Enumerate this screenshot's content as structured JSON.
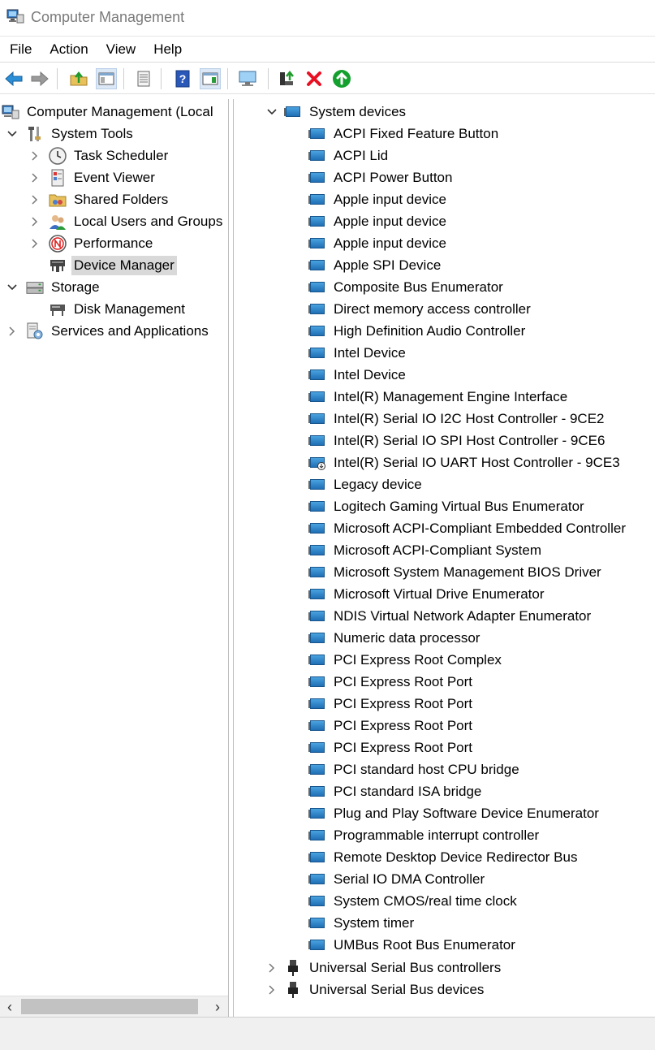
{
  "window": {
    "title": "Computer Management"
  },
  "menu": [
    "File",
    "Action",
    "View",
    "Help"
  ],
  "toolbar": {
    "buttons": [
      "back-icon",
      "forward-icon",
      "up-folder-icon",
      "show-hide-tree-icon",
      "properties-icon",
      "help-icon",
      "show-hide-action-pane-icon",
      "monitor-icon",
      "update-driver-icon",
      "uninstall-icon",
      "enable-device-icon"
    ]
  },
  "left_tree": {
    "root": "Computer Management (Local",
    "system_tools": "System Tools",
    "task_scheduler": "Task Scheduler",
    "event_viewer": "Event Viewer",
    "shared_folders": "Shared Folders",
    "local_users": "Local Users and Groups",
    "performance": "Performance",
    "device_manager": "Device Manager",
    "storage": "Storage",
    "disk_management": "Disk Management",
    "services": "Services and Applications"
  },
  "right_tree": {
    "category": "System devices",
    "devices": [
      "ACPI Fixed Feature Button",
      "ACPI Lid",
      "ACPI Power Button",
      "Apple input device",
      "Apple input device",
      "Apple input device",
      "Apple SPI Device",
      "Composite Bus Enumerator",
      "Direct memory access controller",
      "High Definition Audio Controller",
      "Intel Device",
      "Intel Device",
      "Intel(R) Management Engine Interface",
      "Intel(R) Serial IO I2C Host Controller - 9CE2",
      "Intel(R) Serial IO SPI Host Controller - 9CE6",
      "Intel(R) Serial IO UART Host Controller - 9CE3",
      "Legacy device",
      "Logitech Gaming Virtual Bus Enumerator",
      "Microsoft ACPI-Compliant Embedded Controller",
      "Microsoft ACPI-Compliant System",
      "Microsoft System Management BIOS Driver",
      "Microsoft Virtual Drive Enumerator",
      "NDIS Virtual Network Adapter Enumerator",
      "Numeric data processor",
      "PCI Express Root Complex",
      "PCI Express Root Port",
      "PCI Express Root Port",
      "PCI Express Root Port",
      "PCI Express Root Port",
      "PCI standard host CPU bridge",
      "PCI standard ISA bridge",
      "Plug and Play Software Device Enumerator",
      "Programmable interrupt controller",
      "Remote Desktop Device Redirector Bus",
      "Serial IO DMA Controller",
      "System CMOS/real time clock",
      "System timer",
      "UMBus Root Bus Enumerator"
    ],
    "usb_controllers": "Universal Serial Bus controllers",
    "usb_devices": "Universal Serial Bus devices"
  },
  "colors": {
    "accent": "#1f6fb5",
    "selected": "#d9d9d9",
    "error": "#e81123",
    "ok": "#14a02e"
  }
}
